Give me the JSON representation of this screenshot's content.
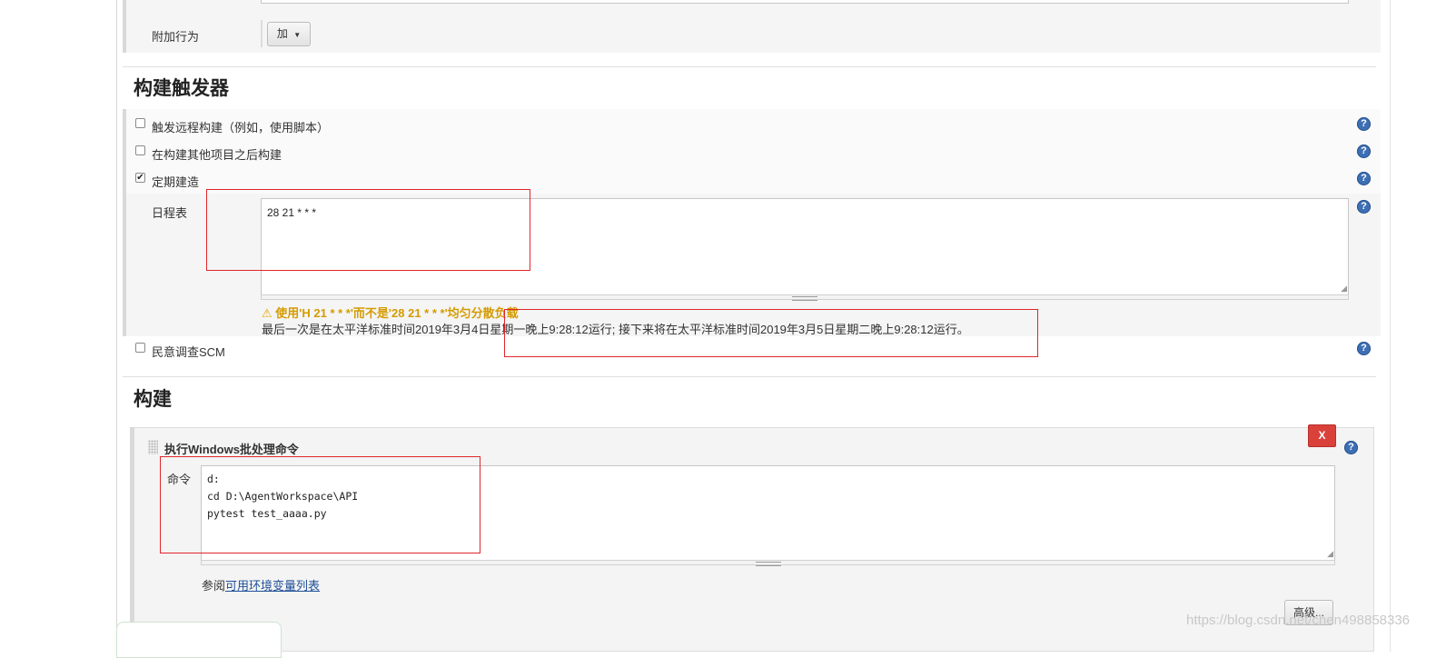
{
  "top_row": {
    "label": "附加行为",
    "add_button": "加"
  },
  "build_triggers": {
    "title": "构建触发器",
    "options": [
      {
        "label": "触发远程构建（例如，使用脚本）",
        "checked": false
      },
      {
        "label": "在构建其他项目之后构建",
        "checked": false
      },
      {
        "label": "定期建造",
        "checked": true
      },
      {
        "label": "民意调查SCM",
        "checked": false
      }
    ],
    "schedule": {
      "label": "日程表",
      "value": "28 21 * * *",
      "warning": "使用'H 21 * * *'而不是'28 21 * * *'均匀分散负载",
      "info": "最后一次是在太平洋标准时间2019年3月4日星期一晚上9:28:12运行; 接下来将在太平洋标准时间2019年3月5日星期二晚上9:28:12运行。"
    }
  },
  "build": {
    "title": "构建",
    "step": {
      "title": "执行Windows批处理命令",
      "delete_label": "X",
      "command_label": "命令",
      "command_lines": [
        "d:",
        "cd D:\\AgentWorkspace\\API",
        "pytest test_aaaa.py"
      ],
      "see_prefix": "参阅",
      "env_link": "可用环境变量列表",
      "advanced_button": "高级..."
    }
  },
  "icons": {
    "help": "help-icon",
    "checkbox": "checkbox-icon",
    "warning": "warning-icon",
    "drag": "drag-handle-icon"
  },
  "watermark": "https://blog.csdn.net/chen498858336",
  "colors": {
    "help": "#3e6fb4",
    "warning": "#d59b00",
    "delete": "#d9413a",
    "highlight": "#e0262c"
  }
}
